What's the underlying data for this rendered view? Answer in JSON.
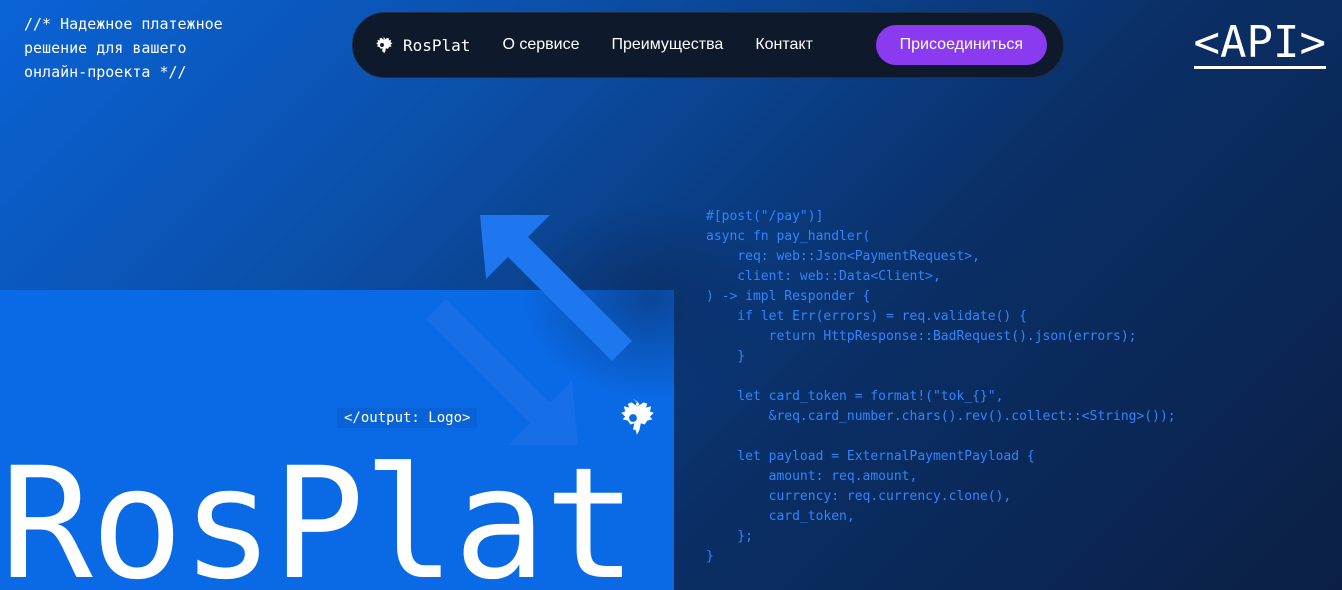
{
  "tagline": "//* Надежное платежное решение для вашего онлайн-проекта *//",
  "nav": {
    "brand": "RosPlat",
    "links": [
      "О сервисе",
      "Преимущества",
      "Контакт"
    ],
    "cta": "Присоединиться",
    "cta_color": "#8a3bef"
  },
  "api_link": "<API>",
  "output_label": "</output: Logo>",
  "hero_title": "RosPlat",
  "code_lines": [
    "#[post(\"/pay\")]",
    "async fn pay_handler(",
    "    req: web::Json<PaymentRequest>,",
    "    client: web::Data<Client>,",
    ") -> impl Responder {",
    "    if let Err(errors) = req.validate() {",
    "        return HttpResponse::BadRequest().json(errors);",
    "    }",
    "",
    "    let card_token = format!(\"tok_{}\",",
    "        &req.card_number.chars().rev().collect::<String>());",
    "",
    "    let payload = ExternalPaymentPayload {",
    "        amount: req.amount,",
    "        currency: req.currency.clone(),",
    "        card_token,",
    "    };",
    "}"
  ],
  "icons": {
    "nav_logo": "eagle-icon",
    "hero_logo": "eagle-icon",
    "arrows": "swap-arrows-icon"
  },
  "colors": {
    "primary_blue": "#0a6ae6",
    "code_blue": "#2f86ff",
    "nav_bg": "#0e1a2c"
  }
}
